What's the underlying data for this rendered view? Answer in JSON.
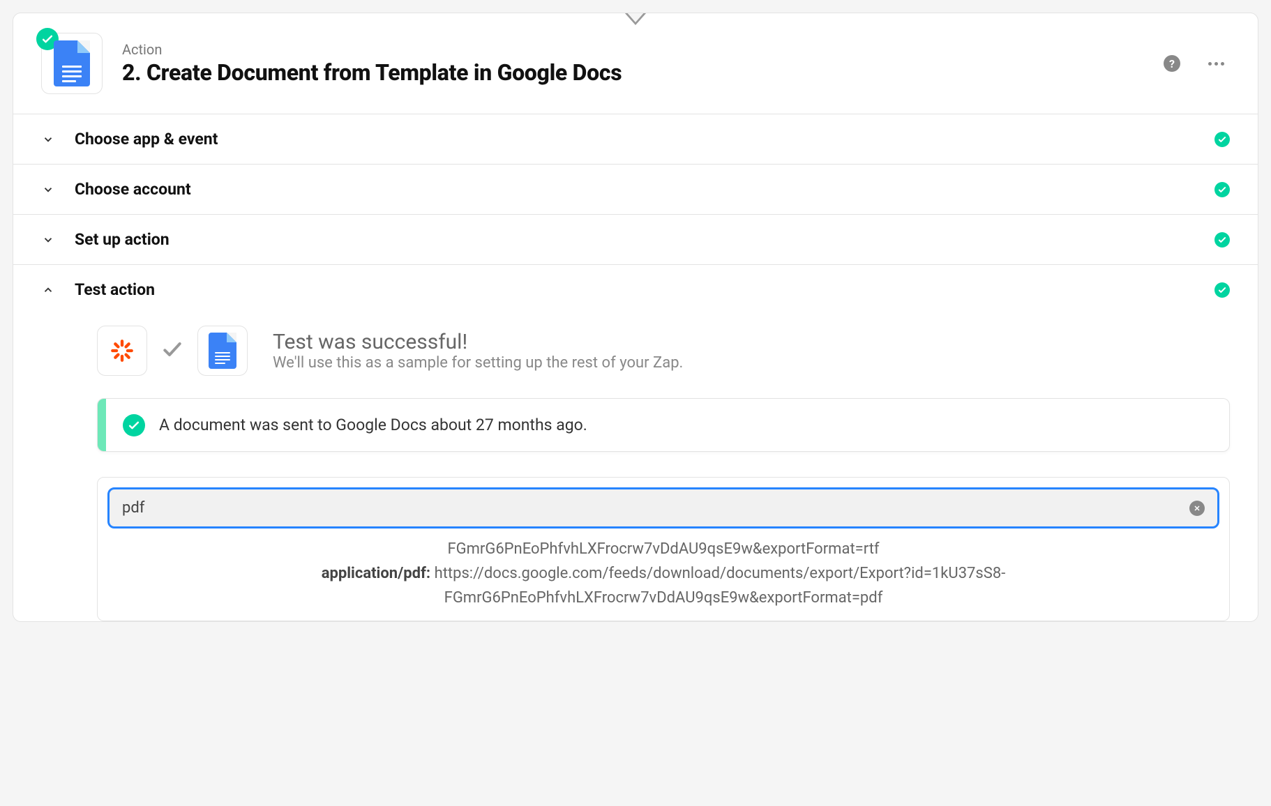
{
  "header": {
    "action_label": "Action",
    "step_title": "2. Create Document from Template in Google Docs"
  },
  "sections": {
    "choose_app": {
      "title": "Choose app & event",
      "completed": true,
      "expanded": false
    },
    "choose_account": {
      "title": "Choose account",
      "completed": true,
      "expanded": false
    },
    "set_up": {
      "title": "Set up action",
      "completed": true,
      "expanded": false
    },
    "test": {
      "title": "Test action",
      "completed": true,
      "expanded": true
    }
  },
  "test_result": {
    "success_title": "Test was successful!",
    "success_subtitle": "We'll use this as a sample for setting up the rest of your Zap.",
    "sent_banner": "A document was sent to Google Docs about 27 months ago."
  },
  "search": {
    "value": "pdf"
  },
  "results": {
    "line1": "FGmrG6PnEoPhfvhLXFrocrw7vDdAU9qsE9w&exportFormat=rtf",
    "key": "application/pdf:",
    "line2a": "https://docs.google.com/feeds/download/documents/export/Export?id=1kU37sS8-",
    "line2b": "FGmrG6PnEoPhfvhLXFrocrw7vDdAU9qsE9w&exportFormat=pdf"
  }
}
